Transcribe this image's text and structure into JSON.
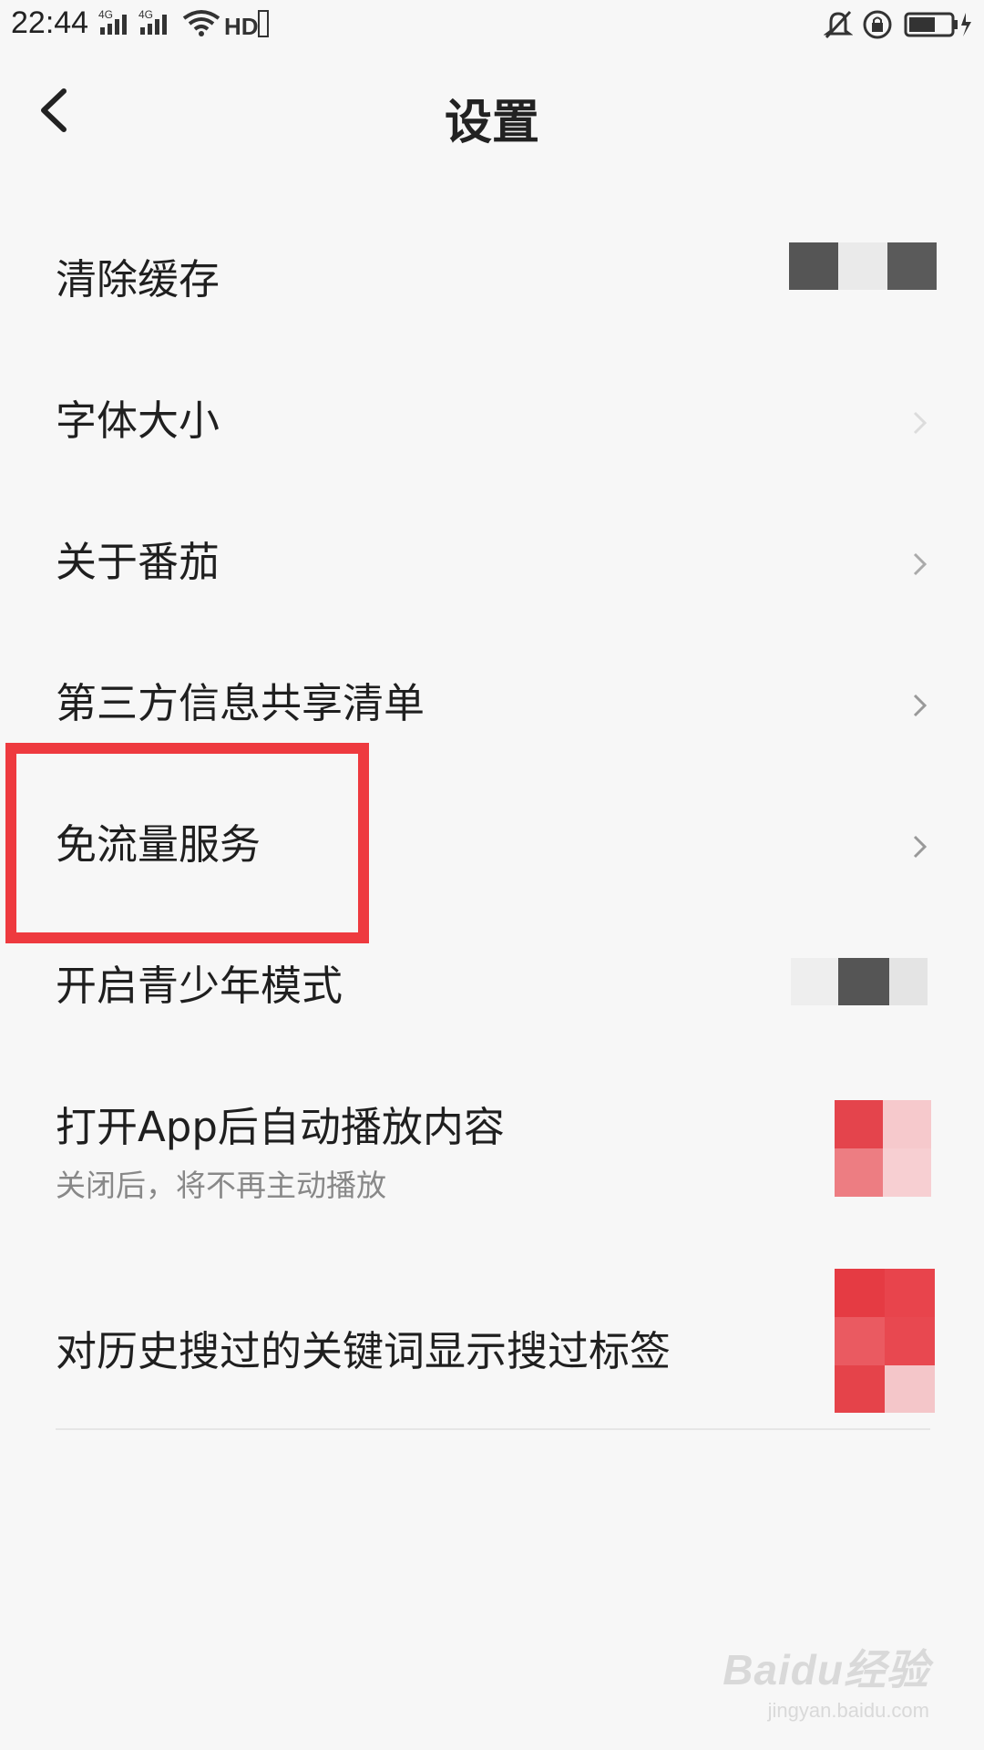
{
  "status_bar": {
    "time": "22:44",
    "network_1": "4G",
    "network_2": "4G",
    "hd_badge": "HD",
    "icons": [
      "signal-icon",
      "signal-icon",
      "wifi-icon",
      "hd-icon",
      "mute-icon",
      "rotation-lock-icon",
      "battery-charging-icon"
    ]
  },
  "header": {
    "title": "设置",
    "back_icon": "back-arrow-icon"
  },
  "settings": {
    "items": [
      {
        "label": "清除缓存"
      },
      {
        "label": "字体大小"
      },
      {
        "label": "关于番茄"
      },
      {
        "label": "第三方信息共享清单"
      },
      {
        "label": "免流量服务"
      },
      {
        "label": "开启青少年模式"
      },
      {
        "label": "打开App后自动播放内容",
        "sub": "关闭后，将不再主动播放"
      },
      {
        "label": "对历史搜过的关键词显示搜过标签"
      }
    ]
  },
  "highlight": {
    "target": "免流量服务",
    "color": "#ee3a3f"
  },
  "watermark": {
    "logo": "Baidu经验",
    "url": "jingyan.baidu.com"
  },
  "colors": {
    "background": "#f7f7f7",
    "text": "#1f1f1f",
    "sub_text": "#888888",
    "accent": "#e53b43"
  }
}
